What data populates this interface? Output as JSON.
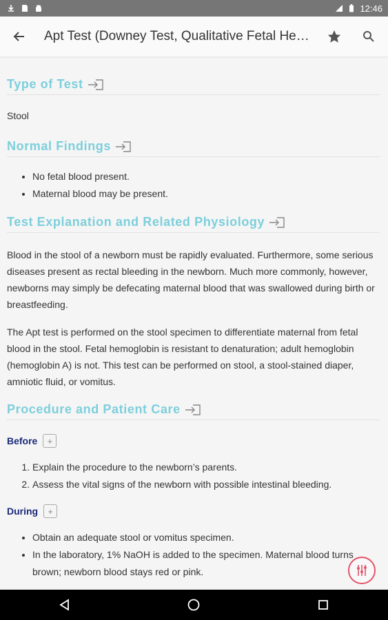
{
  "status_bar": {
    "time": "12:46",
    "icons": [
      "download-icon",
      "sd-card-icon",
      "android-icon",
      "signal-icon",
      "battery-icon"
    ]
  },
  "toolbar": {
    "title": "Apt Test (Downey Test, Qualitative Fetal Hemoglobin)",
    "back_icon": "arrow-back-icon",
    "star_icon": "star-icon",
    "search_icon": "search-icon"
  },
  "sections": {
    "type_of_test": {
      "heading": "Type of Test",
      "body": "Stool"
    },
    "normal_findings": {
      "heading": "Normal Findings",
      "items": [
        "No fetal blood present.",
        "Maternal blood may be present."
      ]
    },
    "explanation": {
      "heading": "Test Explanation and Related Physiology",
      "p1": "Blood in the stool of a newborn must be rapidly evaluated. Furthermore, some serious diseases present as rectal bleeding in the newborn. Much more commonly, however, newborns may simply be defecating maternal blood that was swallowed during birth or breastfeeding.",
      "p2": "The Apt test is performed on the stool specimen to differentiate maternal from fetal blood in the stool. Fetal hemoglobin is resistant to denaturation; adult hemoglobin (hemoglobin A) is not. This test can be performed on stool, a stool-stained diaper, amniotic fluid, or vomitus."
    },
    "procedure": {
      "heading": "Procedure and Patient Care",
      "before": {
        "label": "Before",
        "items": [
          "Explain the procedure to the newborn’s parents.",
          "Assess the vital signs of the newborn with possible intestinal bleeding."
        ]
      },
      "during": {
        "label": "During",
        "items": [
          "Obtain an adequate stool or vomitus specimen.",
          "In the laboratory, 1% NaOH is added to the specimen. Maternal blood turns brown; newborn blood stays red or pink."
        ]
      }
    }
  },
  "colors": {
    "heading": "#7ccfdc",
    "subheading": "#1a2a7a",
    "fab": "#e2536a"
  },
  "nav": {
    "back_icon": "nav-back-icon",
    "home_icon": "nav-home-icon",
    "recents_icon": "nav-recents-icon"
  }
}
